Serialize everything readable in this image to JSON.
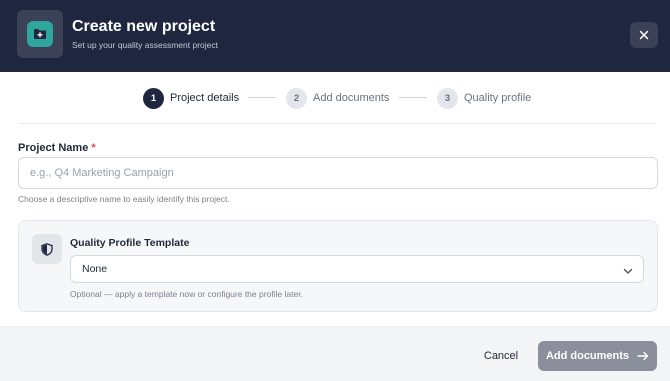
{
  "header": {
    "title": "Create new project",
    "subtitle": "Set up your quality assessment project",
    "icon": "folder-plus-icon",
    "close_icon": "close-icon"
  },
  "stepper": {
    "steps": [
      {
        "number": "1",
        "label": "Project details",
        "active": true
      },
      {
        "number": "2",
        "label": "Add documents",
        "active": false
      },
      {
        "number": "3",
        "label": "Quality profile",
        "active": false
      }
    ]
  },
  "form": {
    "project_name": {
      "label": "Project Name",
      "required_mark": "*",
      "placeholder": "e.g., Q4 Marketing Campaign",
      "value": "",
      "helper": "Choose a descriptive name to easily identify this project."
    },
    "template": {
      "icon": "shield-icon",
      "label": "Quality Profile Template",
      "selected": "None",
      "helper": "Optional — apply a template now or configure the profile later."
    }
  },
  "footer": {
    "cancel_label": "Cancel",
    "submit_label": "Add documents",
    "submit_icon": "arrow-right-icon"
  },
  "colors": {
    "header_bg": "#1e2640",
    "accent_teal": "#2ea69b",
    "required": "#e0455a",
    "primary_disabled": "#8b8f9c"
  }
}
